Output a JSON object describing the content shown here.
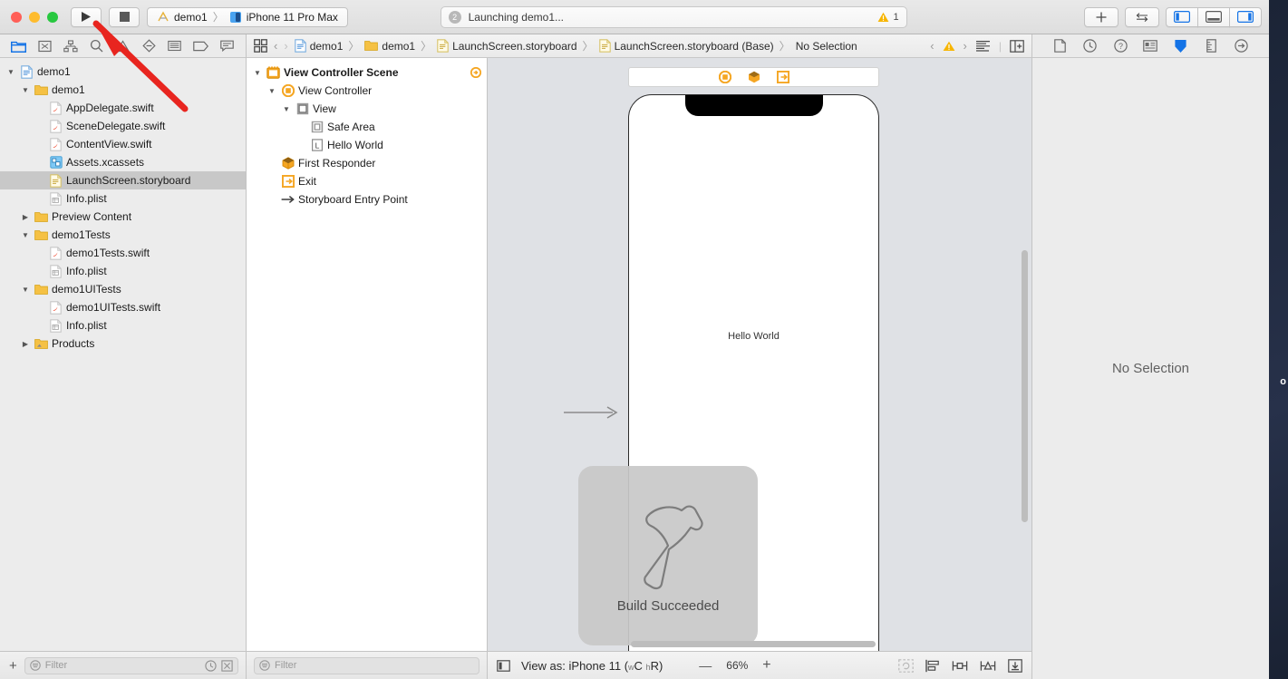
{
  "window": {
    "traffic_lights": [
      "close",
      "minimize",
      "zoom"
    ]
  },
  "toolbar": {
    "run_label": "run-button",
    "stop_label": "stop-button",
    "scheme_project": "demo1",
    "scheme_separator": "〉",
    "scheme_destination": "iPhone 11 Pro Max",
    "status_number": "2",
    "status_text": "Launching demo1...",
    "warning_count": "1",
    "add_label": "+",
    "swap_label": "⇆",
    "panels": [
      {
        "name": "navigator-toggle",
        "active": true
      },
      {
        "name": "debug-area-toggle",
        "active": false
      },
      {
        "name": "inspector-toggle",
        "active": true
      }
    ]
  },
  "navigator": {
    "tabs": [
      {
        "name": "project-navigator",
        "active": true
      },
      {
        "name": "source-control-navigator",
        "active": false
      },
      {
        "name": "symbol-navigator",
        "active": false
      },
      {
        "name": "find-navigator",
        "active": false
      },
      {
        "name": "issue-navigator",
        "active": false
      },
      {
        "name": "test-navigator",
        "active": false
      },
      {
        "name": "debug-navigator",
        "active": false
      },
      {
        "name": "breakpoint-navigator",
        "active": false
      },
      {
        "name": "report-navigator",
        "active": false
      }
    ],
    "tree": [
      {
        "label": "demo1",
        "indent": 0,
        "icon": "project",
        "twisty": "down",
        "selected": false
      },
      {
        "label": "demo1",
        "indent": 1,
        "icon": "folder",
        "twisty": "down",
        "selected": false
      },
      {
        "label": "AppDelegate.swift",
        "indent": 2,
        "icon": "swift",
        "twisty": "",
        "selected": false
      },
      {
        "label": "SceneDelegate.swift",
        "indent": 2,
        "icon": "swift",
        "twisty": "",
        "selected": false
      },
      {
        "label": "ContentView.swift",
        "indent": 2,
        "icon": "swift",
        "twisty": "",
        "selected": false
      },
      {
        "label": "Assets.xcassets",
        "indent": 2,
        "icon": "assets",
        "twisty": "",
        "selected": false
      },
      {
        "label": "LaunchScreen.storyboard",
        "indent": 2,
        "icon": "storyboard",
        "twisty": "",
        "selected": true
      },
      {
        "label": "Info.plist",
        "indent": 2,
        "icon": "plist",
        "twisty": "",
        "selected": false
      },
      {
        "label": "Preview Content",
        "indent": 1,
        "icon": "folder",
        "twisty": "right",
        "selected": false
      },
      {
        "label": "demo1Tests",
        "indent": 1,
        "icon": "folder",
        "twisty": "down",
        "selected": false
      },
      {
        "label": "demo1Tests.swift",
        "indent": 2,
        "icon": "swift",
        "twisty": "",
        "selected": false
      },
      {
        "label": "Info.plist",
        "indent": 2,
        "icon": "plist",
        "twisty": "",
        "selected": false
      },
      {
        "label": "demo1UITests",
        "indent": 1,
        "icon": "folder",
        "twisty": "down",
        "selected": false
      },
      {
        "label": "demo1UITests.swift",
        "indent": 2,
        "icon": "swift",
        "twisty": "",
        "selected": false
      },
      {
        "label": "Info.plist",
        "indent": 2,
        "icon": "plist",
        "twisty": "",
        "selected": false
      },
      {
        "label": "Products",
        "indent": 1,
        "icon": "products",
        "twisty": "right",
        "selected": false
      }
    ],
    "filter_placeholder": "Filter",
    "add_button": "+"
  },
  "editor": {
    "breadcrumbs": [
      {
        "label": "demo1",
        "icon": "project"
      },
      {
        "label": "demo1",
        "icon": "folder"
      },
      {
        "label": "LaunchScreen.storyboard",
        "icon": "storyboard"
      },
      {
        "label": "LaunchScreen.storyboard (Base)",
        "icon": "storyboard"
      },
      {
        "label": "No Selection",
        "icon": ""
      }
    ],
    "separator": "〉"
  },
  "outline": {
    "tree": [
      {
        "label": "View Controller Scene",
        "indent": 0,
        "icon": "scene",
        "twisty": "down",
        "bold": true
      },
      {
        "label": "View Controller",
        "indent": 1,
        "icon": "viewcontroller",
        "twisty": "down",
        "bold": false
      },
      {
        "label": "View",
        "indent": 2,
        "icon": "view",
        "twisty": "down",
        "bold": false
      },
      {
        "label": "Safe Area",
        "indent": 3,
        "icon": "safearea",
        "twisty": "",
        "bold": false
      },
      {
        "label": "Hello World",
        "indent": 3,
        "icon": "label",
        "twisty": "",
        "bold": false
      },
      {
        "label": "First Responder",
        "indent": 1,
        "icon": "firstresponder",
        "twisty": "",
        "bold": false
      },
      {
        "label": "Exit",
        "indent": 1,
        "icon": "exit",
        "twisty": "",
        "bold": false
      },
      {
        "label": "Storyboard Entry Point",
        "indent": 1,
        "icon": "entrypoint",
        "twisty": "",
        "bold": false
      }
    ],
    "filter_placeholder": "Filter"
  },
  "canvas": {
    "scene_dock_icons": [
      "view-controller-icon",
      "first-responder-icon",
      "exit-icon"
    ],
    "device_label_text": "Hello World",
    "hud": {
      "icon": "hammer-icon",
      "label": "Build Succeeded"
    }
  },
  "canvas_bar": {
    "view_as_prefix": "View as: iPhone 11 (",
    "view_as_wc": "w",
    "view_as_c": "C ",
    "view_as_h": "h",
    "view_as_r": "R)",
    "zoom_out": "—",
    "zoom_value": "66%",
    "zoom_in": "+",
    "tools": [
      "update-frames-icon",
      "align-icon",
      "add-constraints-icon",
      "resolve-issues-icon",
      "embed-in-icon"
    ]
  },
  "inspector": {
    "tabs": [
      {
        "name": "file-inspector",
        "active": false
      },
      {
        "name": "history-inspector",
        "active": false
      },
      {
        "name": "quick-help-inspector",
        "active": false
      },
      {
        "name": "identity-inspector",
        "active": false
      },
      {
        "name": "attributes-inspector",
        "active": true
      },
      {
        "name": "size-inspector",
        "active": false
      },
      {
        "name": "connections-inspector",
        "active": false
      }
    ],
    "empty_message": "No Selection"
  },
  "annotation": {
    "arrow": "red-pointer-arrow",
    "color": "#e8251f"
  },
  "colors": {
    "accent_blue": "#1473e6",
    "warning_yellow": "#f7b500",
    "folder_yellow": "#f5c144",
    "selection_gray": "#c8c8c8"
  }
}
